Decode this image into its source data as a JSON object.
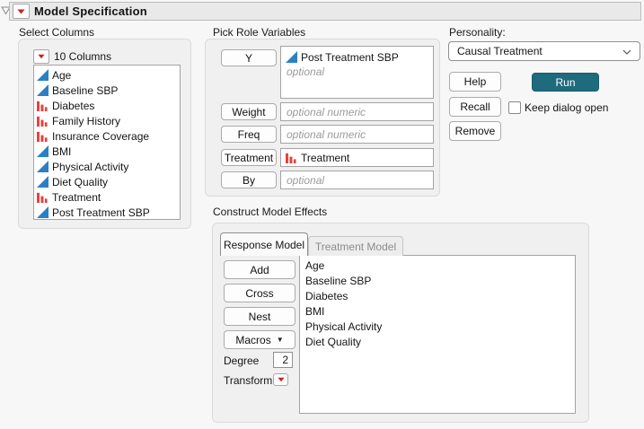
{
  "header": {
    "title": "Model Specification"
  },
  "select_columns": {
    "label": "Select Columns",
    "count_label": "10 Columns",
    "items": [
      {
        "name": "Age",
        "type": "continuous"
      },
      {
        "name": "Baseline SBP",
        "type": "continuous"
      },
      {
        "name": "Diabetes",
        "type": "nominal"
      },
      {
        "name": "Family History",
        "type": "nominal"
      },
      {
        "name": "Insurance Coverage",
        "type": "nominal"
      },
      {
        "name": "BMI",
        "type": "continuous"
      },
      {
        "name": "Physical Activity",
        "type": "continuous"
      },
      {
        "name": "Diet Quality",
        "type": "continuous"
      },
      {
        "name": "Treatment",
        "type": "nominal"
      },
      {
        "name": "Post Treatment SBP",
        "type": "continuous"
      }
    ]
  },
  "pick_roles": {
    "label": "Pick Role Variables",
    "rows": [
      {
        "button": "Y",
        "value": "Post Treatment SBP",
        "value_type": "continuous",
        "placeholder": "optional"
      },
      {
        "button": "Weight",
        "placeholder": "optional numeric"
      },
      {
        "button": "Freq",
        "placeholder": "optional numeric"
      },
      {
        "button": "Treatment",
        "value": "Treatment",
        "value_type": "nominal"
      },
      {
        "button": "By",
        "placeholder": "optional"
      }
    ]
  },
  "personality": {
    "label": "Personality:",
    "selected": "Causal Treatment",
    "help": "Help",
    "run": "Run",
    "recall": "Recall",
    "remove": "Remove",
    "keep_dialog_label": "Keep dialog open",
    "keep_dialog_checked": false
  },
  "model_effects": {
    "label": "Construct Model Effects",
    "tabs": [
      {
        "label": "Response Model",
        "active": true
      },
      {
        "label": "Treatment Model",
        "active": false
      }
    ],
    "buttons": [
      "Add",
      "Cross",
      "Nest"
    ],
    "macros_label": "Macros",
    "degree_label": "Degree",
    "degree_value": "2",
    "transform_label": "Transform",
    "effects": [
      "Age",
      "Baseline SBP",
      "Diabetes",
      "BMI",
      "Physical Activity",
      "Diet Quality"
    ]
  },
  "colors": {
    "run_button": "#1f6b7e",
    "continuous_icon": "#2b80c4",
    "nominal_icon": "#e8413e",
    "menu_triangle": "#cc2222"
  }
}
